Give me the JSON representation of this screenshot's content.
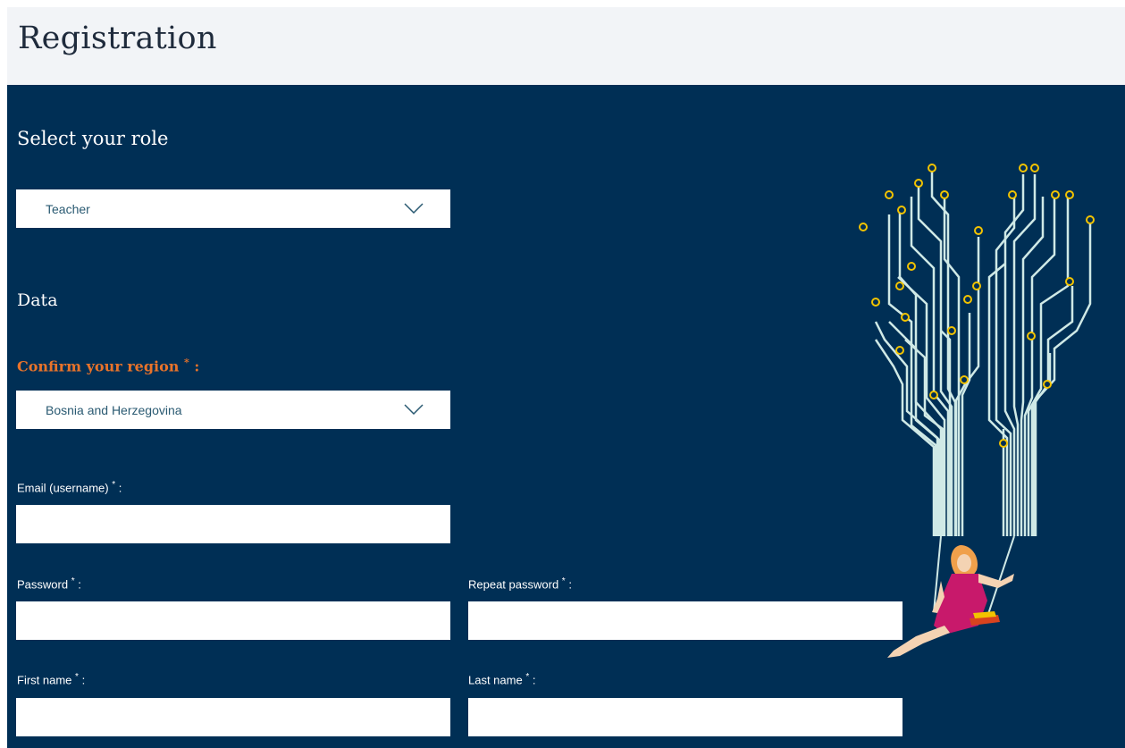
{
  "header": {
    "title": "Registration"
  },
  "role": {
    "title": "Select your role",
    "selected": "Teacher"
  },
  "data_section": {
    "title": "Data"
  },
  "region": {
    "label": "Confirm your region",
    "required_mark": "*",
    "colon": ":",
    "selected": "Bosnia and Herzegovina"
  },
  "fields": {
    "email": {
      "label": "Email (username)",
      "value": ""
    },
    "password": {
      "label": "Password",
      "value": ""
    },
    "repeat_password": {
      "label": "Repeat password",
      "value": ""
    },
    "first_name": {
      "label": "First name",
      "value": ""
    },
    "last_name": {
      "label": "Last name",
      "value": ""
    },
    "required_mark": "*",
    "colon": ":"
  },
  "colors": {
    "panel_bg": "#002f55",
    "header_bg": "#f2f4f7",
    "accent_orange": "#e8732a",
    "node_yellow": "#f2c300",
    "wire_light": "#cfe9e6"
  },
  "illustration": {
    "subject": "girl on swing with circuit-tree ropes"
  }
}
